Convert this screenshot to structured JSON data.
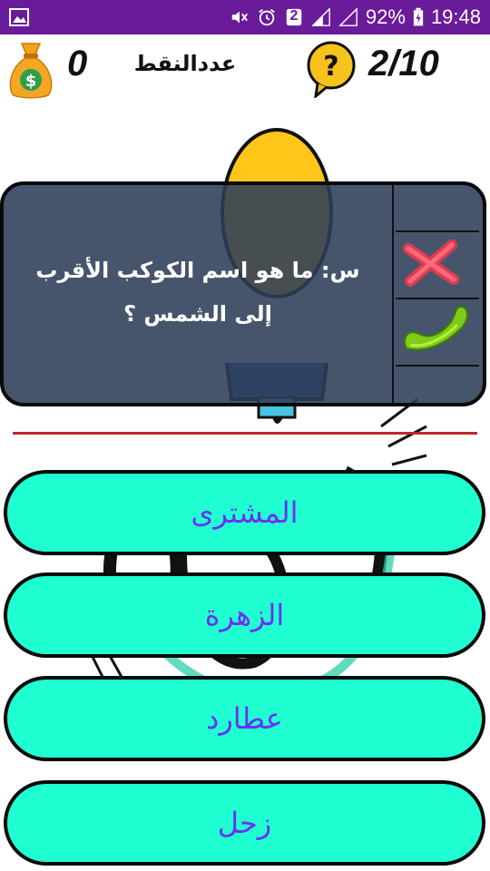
{
  "status_bar": {
    "battery": "92%",
    "time": "19:48",
    "sim_badge": "2",
    "icons": [
      "gallery-icon",
      "mute-icon",
      "alarm-icon",
      "sim-icon",
      "signal-icon",
      "no-signal-icon",
      "battery-icon"
    ]
  },
  "header": {
    "score_value": "0",
    "score_label": "عددالنقط",
    "progress": "2/10",
    "help_symbol": "?",
    "money_symbol": "$"
  },
  "question": {
    "text": "س: ما هو اسم الكوكب الأقرب إلى الشمس ؟"
  },
  "answers": [
    {
      "label": "المشترى"
    },
    {
      "label": "الزهرة"
    },
    {
      "label": "عطارد"
    },
    {
      "label": "زحل"
    }
  ],
  "colors": {
    "status_bar": "#6a1b9a",
    "card_bg": "#2c3e58",
    "answer_bg": "#1fffd2",
    "answer_text": "#6a32f0",
    "divider_red": "#c0272d"
  }
}
